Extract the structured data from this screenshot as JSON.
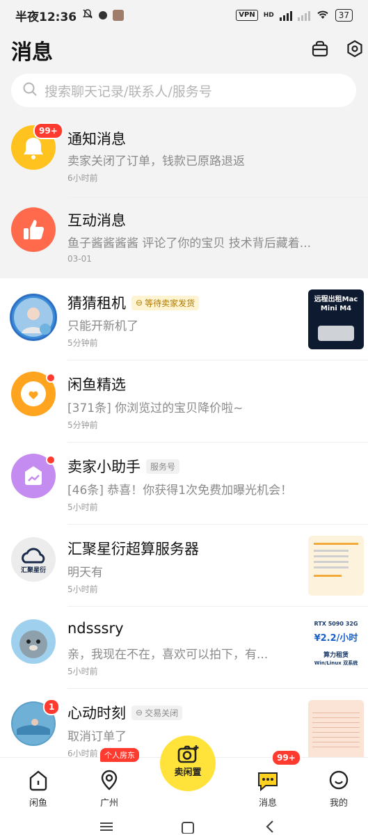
{
  "status_bar": {
    "time": "半夜12:36",
    "vpn": "VPN",
    "hd": "HD",
    "battery": "37"
  },
  "header": {
    "title": "消息"
  },
  "search": {
    "placeholder": "搜索聊天记录/联系人/服务号"
  },
  "conversations": [
    {
      "name": "通知消息",
      "preview": "卖家关闭了订单，钱款已原路退返",
      "time": "6小时前",
      "badge": "99+"
    },
    {
      "name": "互动消息",
      "preview": "鱼子酱酱酱酱 评论了你的宝贝 技术背后藏着...",
      "time": "03-01"
    },
    {
      "name": "猜猜租机",
      "tag": "等待卖家发货",
      "preview": "只能开新机了",
      "time": "5分钟前",
      "thumb_lines": [
        "远程出租Mac",
        "Mini M4"
      ]
    },
    {
      "name": "闲鱼精选",
      "preview": "[371条] 你浏览过的宝贝降价啦~",
      "time": "5分钟前"
    },
    {
      "name": "卖家小助手",
      "tag": "服务号",
      "preview": "[46条] 恭喜！你获得1次免费加曝光机会！",
      "time": "5小时前"
    },
    {
      "name": "汇聚星衍超算服务器",
      "preview": "明天有",
      "time": "5小时前",
      "avatar_text": "汇聚星衍"
    },
    {
      "name": "ndsssry",
      "preview": "亲，我现在不在，喜欢可以拍下，有...",
      "time": "5小时前",
      "thumb_lines": [
        "RTX 5090 32G",
        "¥2.2/小时",
        "算力租赁",
        "Win/Linux 双系统"
      ]
    },
    {
      "name": "心动时刻",
      "tag": "交易关闭",
      "preview": "取消订单了",
      "time": "6小时前",
      "badge": "1"
    }
  ],
  "bottom_nav": {
    "items": [
      "闲鱼",
      "广州",
      "卖闲置",
      "消息",
      "我的"
    ],
    "guangzhou_badge": "个人房东",
    "messages_badge": "99+"
  },
  "colors": {
    "accent_yellow": "#ffe33a",
    "badge_red": "#ff3b30",
    "notify_yellow": "#ffc21e",
    "interact_red": "#ff6a4d",
    "picks_orange": "#ffa41f",
    "helper_purple": "#c48bf0"
  }
}
